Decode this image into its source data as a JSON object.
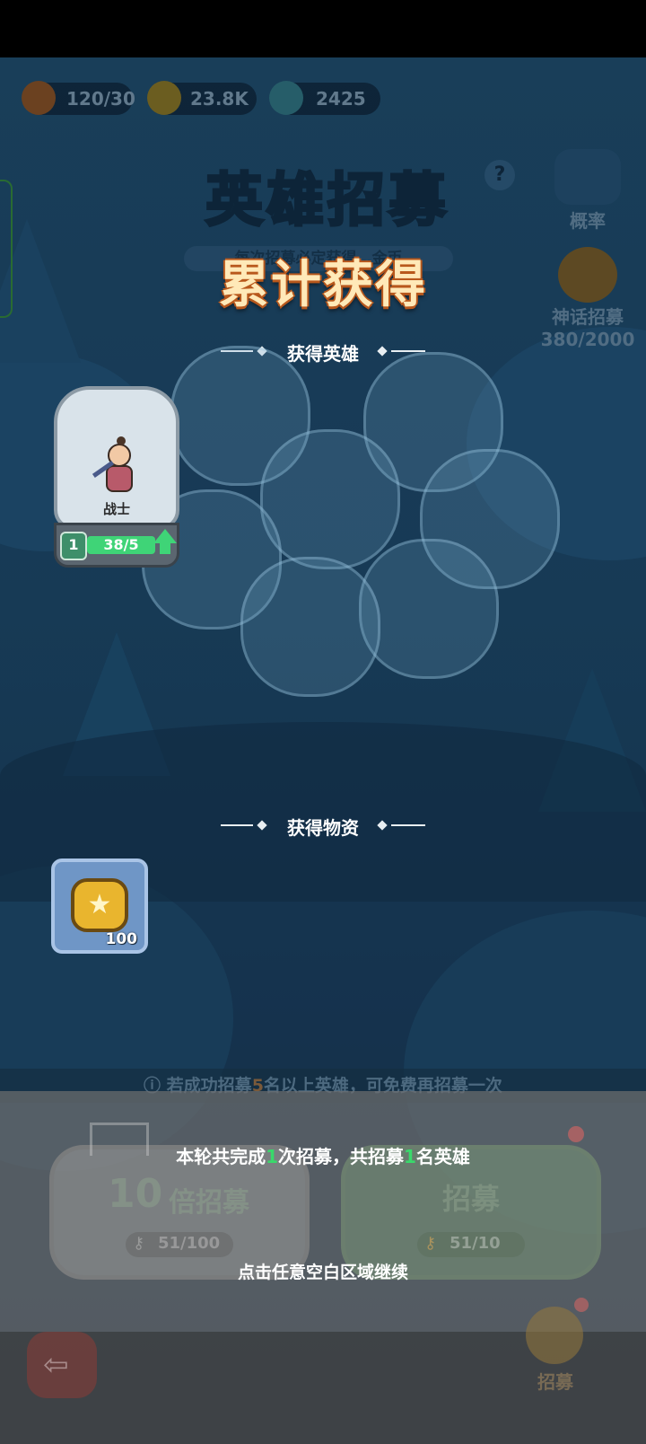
{
  "resources": {
    "energy": {
      "value": "120/30",
      "icon": "flame-icon"
    },
    "gold": {
      "value": "23.8K",
      "icon": "coin-icon"
    },
    "gems": {
      "value": "2425",
      "icon": "crystal-icon"
    }
  },
  "header": {
    "background_title": "英雄招募",
    "background_subtitle": "每次招募必定获得…金币",
    "overlay_title": "累计获得"
  },
  "side": {
    "probability_label": "概率",
    "myth_recruit_label": "神话招募",
    "myth_recruit_progress": "380/2000"
  },
  "heroes_section": {
    "title": "获得英雄",
    "hero": {
      "name": "战士",
      "level": "1",
      "shards": "38/5",
      "shard_fill": 1.0
    }
  },
  "items_section": {
    "title": "获得物资",
    "item": {
      "icon": "gold-coin-icon",
      "count": "100"
    }
  },
  "recruit_hint": {
    "prefix": "若成功招募",
    "highlight": "5",
    "suffix": "名以上英雄，可免费再招募一次"
  },
  "summary": {
    "part1": "本轮共完成",
    "recruit_count": "1",
    "part2": "次招募，共招募",
    "hero_count": "1",
    "part3": "名英雄",
    "continue_text": "点击任意空白区域继续"
  },
  "buttons": {
    "ten_times": {
      "number": "10",
      "label": "倍招募",
      "cost": "51/100"
    },
    "single": {
      "label": "招募",
      "cost": "51/10"
    }
  },
  "bottom_nav": {
    "recruit_label": "招募"
  },
  "colors": {
    "highlight_green": "#39d96b",
    "overlay_title": "#ffe9b8"
  }
}
